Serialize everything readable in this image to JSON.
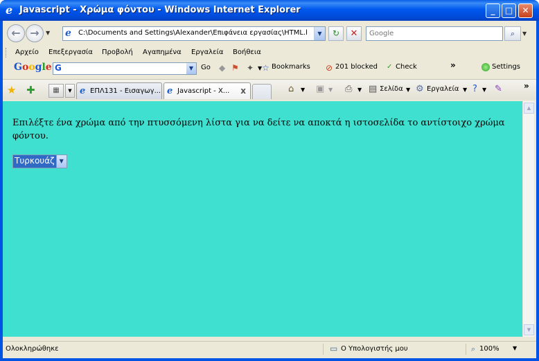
{
  "window": {
    "title": "Javascript - Χρώμα φόντου - Windows Internet Explorer",
    "icon": "ie-logo-icon"
  },
  "address_bar": {
    "url": "C:\\Documents and Settings\\Alexander\\Επιφάνεια εργασίας\\HTML.html",
    "search_placeholder": "Google"
  },
  "menu": {
    "items": [
      "Αρχείο",
      "Επεξεργασία",
      "Προβολή",
      "Αγαπημένα",
      "Εργαλεία",
      "Βοήθεια"
    ]
  },
  "google_toolbar": {
    "go_label": "Go",
    "bookmarks_label": "Bookmarks",
    "blocked_label": "201 blocked",
    "check_label": "Check",
    "more_label": "»",
    "settings_label": "Settings"
  },
  "tabs": {
    "items": [
      {
        "label": "ΕΠΛ131 - Εισαγωγ..."
      },
      {
        "label": "Javascript - Χ..."
      }
    ],
    "close_glyph": "x"
  },
  "command_bar": {
    "page_label": "Σελίδα",
    "tools_label": "Εργαλεία",
    "more_label": "»"
  },
  "page": {
    "background_color": "#40e0d0",
    "instruction_text": "Επιλέξτε ένα χρώμα από την πτυσσόμενη λίστα για να δείτε να αποκτά η ιστοσελίδα το αντίστοιχο χρώμα φόντου.",
    "color_select_value": "Τυρκουάζ"
  },
  "status_bar": {
    "status_text": "Ολοκληρώθηκε",
    "zone_label": "Ο Υπολογιστής μου",
    "zoom_label": "100%"
  }
}
